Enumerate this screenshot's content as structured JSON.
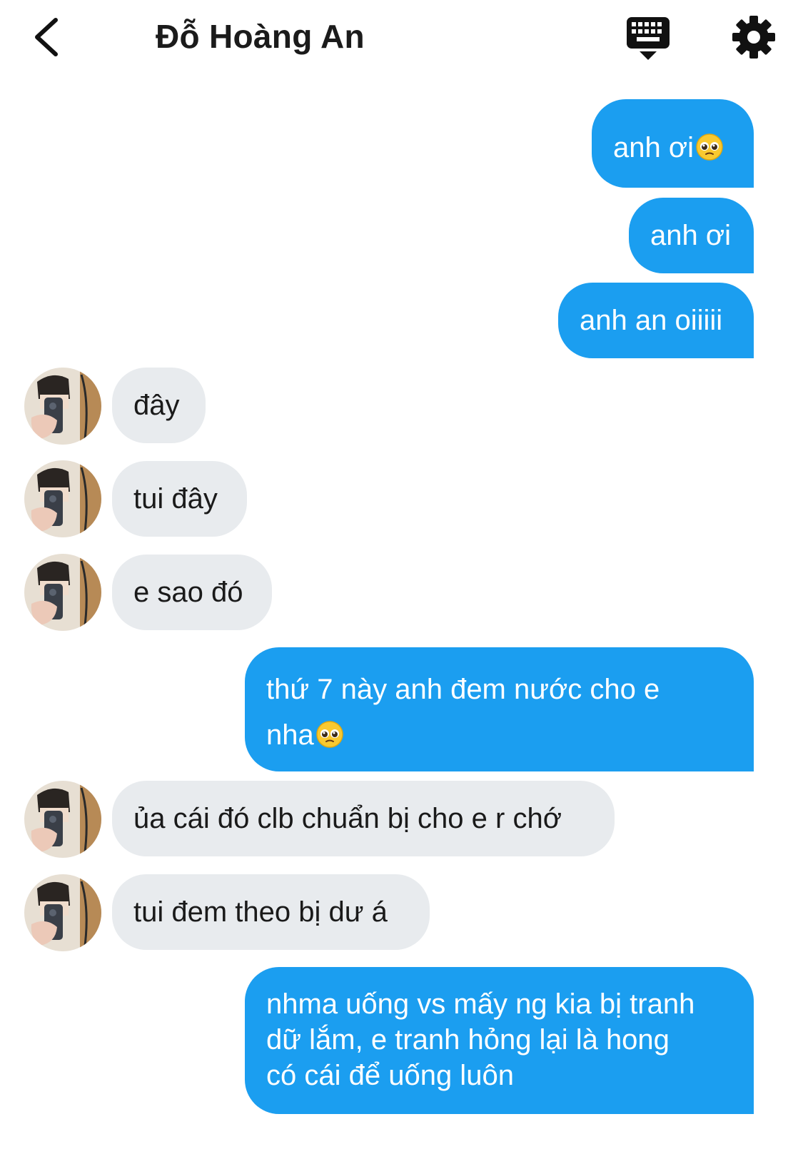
{
  "header": {
    "title": "Đỗ Hoàng An",
    "back_icon": "chevron-left-icon",
    "keyboard_icon": "keyboard-icon",
    "settings_icon": "gear-icon"
  },
  "colors": {
    "outgoing_bubble": "#1b9ef0",
    "incoming_bubble": "#e8ebee",
    "outgoing_text": "#ffffff",
    "incoming_text": "#1a1a1a"
  },
  "messages": [
    {
      "sender": "me",
      "text": "anh ơi",
      "emoji": "pleading-face-emoji"
    },
    {
      "sender": "me",
      "text": "anh ơi"
    },
    {
      "sender": "me",
      "text": "anh an oiiiii"
    },
    {
      "sender": "them",
      "text": "đây"
    },
    {
      "sender": "them",
      "text": "tui đây"
    },
    {
      "sender": "them",
      "text": "e sao đó"
    },
    {
      "sender": "me",
      "line1": "thứ 7 này anh đem nước cho e",
      "line2": "nha",
      "emoji": "pleading-face-emoji"
    },
    {
      "sender": "them",
      "text": "ủa cái đó clb chuẩn bị cho e r chớ"
    },
    {
      "sender": "them",
      "text": "tui đem theo bị dư á"
    },
    {
      "sender": "me",
      "line1": "nhma uống vs mấy ng kia bị tranh",
      "line2": "dữ lắm, e tranh hỏng lại là hong",
      "line3": "có cái để uống luôn"
    }
  ]
}
